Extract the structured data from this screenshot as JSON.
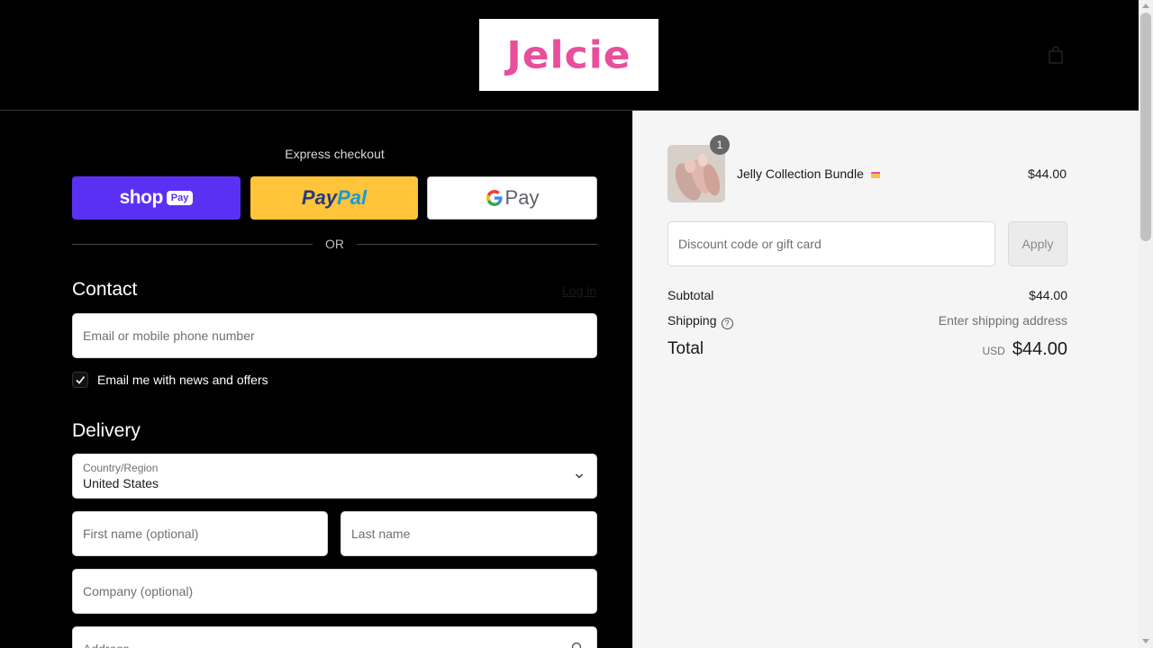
{
  "brand": {
    "logo_text": "Jelcie"
  },
  "header": {
    "cart_icon": "shopping-bag-icon"
  },
  "express": {
    "label": "Express checkout",
    "shop_word": "shop",
    "shop_pill": "Pay",
    "paypal_a": "Pay",
    "paypal_b": "Pal",
    "gpay_g": "G",
    "gpay_pay": "Pay",
    "or": "OR"
  },
  "contact": {
    "title": "Contact",
    "login": "Log in",
    "email_placeholder": "Email or mobile phone number",
    "newsletter_label": "Email me with news and offers",
    "newsletter_checked": true
  },
  "delivery": {
    "title": "Delivery",
    "country_label": "Country/Region",
    "country_value": "United States",
    "first_name_placeholder": "First name (optional)",
    "last_name_placeholder": "Last name",
    "company_placeholder": "Company (optional)",
    "address_placeholder": "Address"
  },
  "summary": {
    "item": {
      "name": "Jelly Collection Bundle",
      "price": "$44.00",
      "quantity": "1"
    },
    "discount_placeholder": "Discount code or gift card",
    "apply": "Apply",
    "subtotal_label": "Subtotal",
    "subtotal_value": "$44.00",
    "shipping_label": "Shipping",
    "shipping_value": "Enter shipping address",
    "total_label": "Total",
    "currency": "USD",
    "total_value": "$44.00"
  },
  "colors": {
    "shop_pay": "#5a31f4",
    "paypal": "#ffc439",
    "brand_pink": "#e94e9b"
  }
}
